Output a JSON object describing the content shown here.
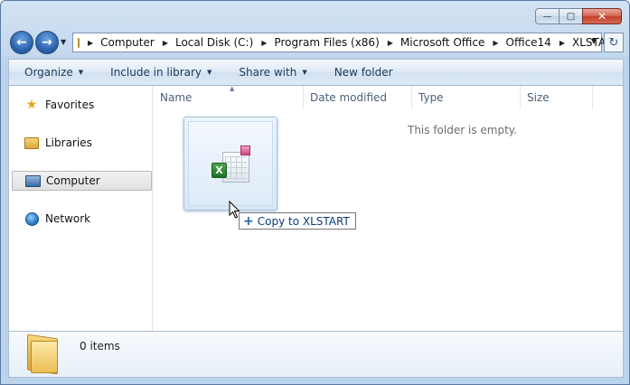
{
  "breadcrumb": [
    "Computer",
    "Local Disk (C:)",
    "Program Files (x86)",
    "Microsoft Office",
    "Office14",
    "XLSTART"
  ],
  "toolbar": {
    "organize": "Organize",
    "include": "Include in library",
    "share": "Share with",
    "new_folder": "New folder"
  },
  "nav_pane": {
    "favorites": "Favorites",
    "libraries": "Libraries",
    "computer": "Computer",
    "network": "Network"
  },
  "columns": {
    "name": "Name",
    "date_modified": "Date modified",
    "type": "Type",
    "size": "Size"
  },
  "empty_message": "This folder is empty.",
  "drag_tooltip": "Copy to XLSTART",
  "details": {
    "count": "0 items"
  },
  "icons": {
    "back": "back-arrow-icon",
    "forward": "forward-arrow-icon",
    "refresh": "refresh-icon",
    "favorites": "star-icon",
    "libraries": "library-icon",
    "computer": "computer-icon",
    "network": "network-globe-icon",
    "dragged": "excel-file-icon"
  },
  "colors": {
    "accent": "#1e395b",
    "selection": "#e1e1e1",
    "close": "#c2412b"
  }
}
